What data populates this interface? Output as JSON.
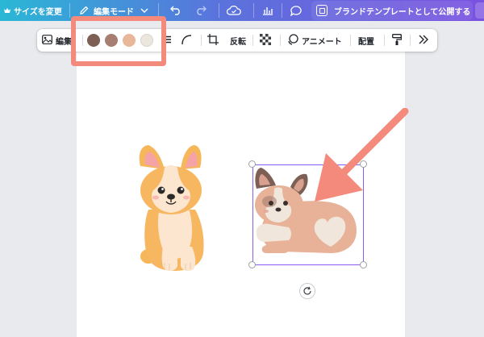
{
  "header": {
    "resize_label": "サイズを変更",
    "edit_mode_label": "編集モード",
    "publish_label": "ブランドテンプレートとして公開する"
  },
  "toolbar": {
    "edit_image_label": "編集",
    "flip_label": "反転",
    "animate_label": "アニメート",
    "position_label": "配置",
    "swatches": [
      "#7d5f55",
      "#a67f72",
      "#e8b699",
      "#ebe6de"
    ]
  },
  "colors": {
    "header_gradient": [
      "#2ab7d6",
      "#5a73dc",
      "#7a52e0"
    ],
    "highlight": "#f48a7b",
    "selection": "#8b5cf6",
    "canvas_bg": "#e8eaed"
  }
}
